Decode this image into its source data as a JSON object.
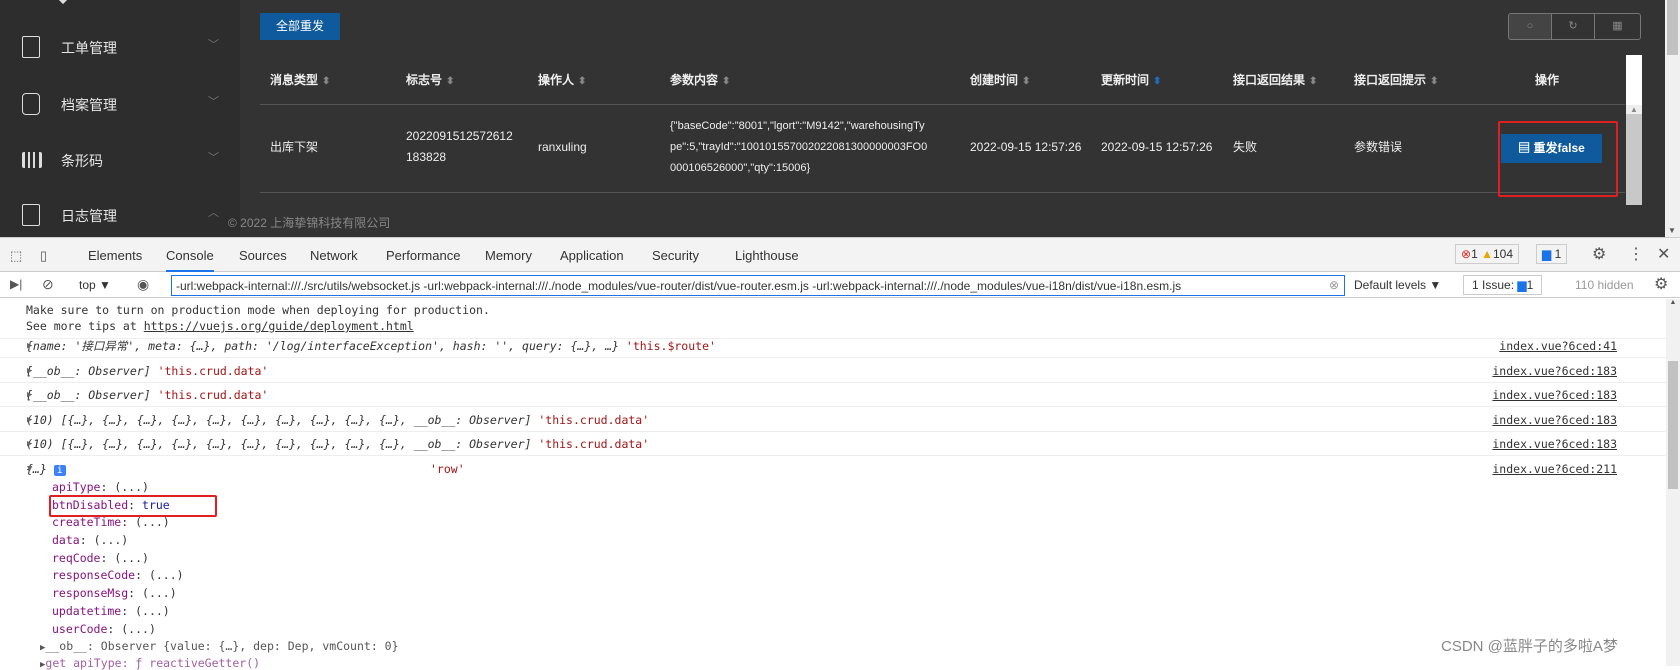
{
  "sidebar": {
    "items": [
      {
        "label": "工单管理",
        "icon": "ticket-gear-icon",
        "expanded": false
      },
      {
        "label": "档案管理",
        "icon": "document-icon",
        "expanded": false
      },
      {
        "label": "条形码",
        "icon": "barcode-icon",
        "expanded": false
      },
      {
        "label": "日志管理",
        "icon": "log-gear-icon",
        "expanded": true
      }
    ]
  },
  "main": {
    "resend_all": "全部重发",
    "toolbar": [
      "search-icon",
      "refresh-icon",
      "columns-icon"
    ],
    "columns": [
      "消息类型",
      "标志号",
      "操作人",
      "参数内容",
      "创建时间",
      "更新时间",
      "接口返回结果",
      "接口返回提示",
      "操作"
    ],
    "row": {
      "type": "出库下架",
      "id_line1": "2022091512572612",
      "id_line2": "183828",
      "operator": "ranxuling",
      "params_line1": "{\"baseCode\":\"8001\",\"lgort\":\"M9142\",\"warehousingTy",
      "params_line2": "pe\":5,\"trayId\":\"100101557002022081300000003FO0",
      "params_line3": "000106526000\",\"qty\":15006}",
      "create_time": "2022-09-15 12:57:26",
      "update_time": "2022-09-15 12:57:26",
      "result": "失败",
      "message": "参数错误",
      "action": "重发false"
    },
    "footer": "© 2022 上海挚锦科技有限公司"
  },
  "devtools": {
    "tabs": [
      "Elements",
      "Console",
      "Sources",
      "Network",
      "Performance",
      "Memory",
      "Application",
      "Security",
      "Lighthouse"
    ],
    "active_tab": "Console",
    "errors": "1",
    "warnings": "104",
    "issues_badge": "1",
    "context": "top",
    "filter": "-url:webpack-internal:///./src/utils/websocket.js -url:webpack-internal:///./node_modules/vue-router/dist/vue-router.esm.js -url:webpack-internal:///./node_modules/vue-i18n/dist/vue-i18n.esm.js",
    "levels": "Default levels",
    "issue_label": "1 Issue:",
    "issue_count": "1",
    "hidden": "110 hidden"
  },
  "console": {
    "msg1": "Make sure to turn on production mode when deploying for production.",
    "msg2_prefix": "See more tips at ",
    "msg2_link": "https://vuejs.org/guide/deployment.html",
    "lines": [
      {
        "obj": "{name: '接口异常', meta: {…}, path: '/log/interfaceException', hash: '', query: {…}, …}",
        "label": "'this.$route'",
        "src": "index.vue?6ced:41"
      },
      {
        "obj": "[__ob__: Observer]",
        "label": "'this.crud.data'",
        "src": "index.vue?6ced:183"
      },
      {
        "obj": "[__ob__: Observer]",
        "label": "'this.crud.data'",
        "src": "index.vue?6ced:183"
      },
      {
        "obj": "(10) [{…}, {…}, {…}, {…}, {…}, {…}, {…}, {…}, {…}, {…}, __ob__: Observer]",
        "label": "'this.crud.data'",
        "src": "index.vue?6ced:183"
      },
      {
        "obj": "(10) [{…}, {…}, {…}, {…}, {…}, {…}, {…}, {…}, {…}, {…}, __ob__: Observer]",
        "label": "'this.crud.data'",
        "src": "index.vue?6ced:183"
      },
      {
        "obj": "{…}",
        "label": "'row'",
        "src": "index.vue?6ced:211"
      }
    ],
    "props": [
      [
        "apiType",
        "(...)"
      ],
      [
        "btnDisabled",
        "true"
      ],
      [
        "createTime",
        "(...)"
      ],
      [
        "data",
        "(...)"
      ],
      [
        "reqCode",
        "(...)"
      ],
      [
        "responseCode",
        "(...)"
      ],
      [
        "responseMsg",
        "(...)"
      ],
      [
        "updatetime",
        "(...)"
      ],
      [
        "userCode",
        "(...)"
      ]
    ],
    "ob_line": "__ob__: Observer {value: {…}, dep: Dep, vmCount: 0}",
    "getter_line": "get apiType: ƒ reactiveGetter()"
  },
  "watermark": "CSDN @蓝胖子的多啦A梦"
}
